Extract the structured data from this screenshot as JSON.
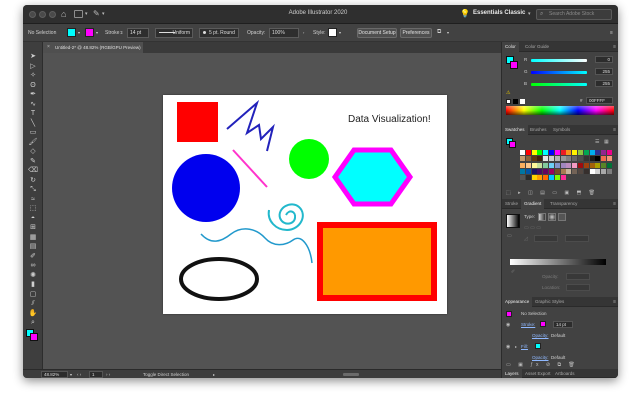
{
  "app": {
    "title": "Adobe Illustrator 2020",
    "workspace": "Essentials Classic",
    "stock_search_placeholder": "Search Adobe Stock"
  },
  "control_bar": {
    "selection": "No Selection",
    "stroke_label": "Stroke:",
    "stroke_weight": "14 pt",
    "variable_width": "Uniform",
    "brush": "5 pt. Round",
    "opacity_label": "Opacity:",
    "opacity_value": "100%",
    "style_label": "Style:",
    "document_setup": "Document Setup",
    "preferences": "Preferences",
    "fill_color": "#00ffff",
    "stroke_color": "#ff00ff"
  },
  "document_tab": {
    "label": "Untitled-2* @ 48.82% (RGB/GPU Preview)"
  },
  "toolbar": {
    "tools": [
      "selection-tool",
      "direct-selection-tool",
      "magic-wand-tool",
      "lasso-tool",
      "pen-tool",
      "curvature-tool",
      "type-tool",
      "line-tool",
      "rectangle-tool",
      "paintbrush-tool",
      "shaper-tool",
      "pencil-tool",
      "eraser-tool",
      "rotate-tool",
      "scale-tool",
      "width-tool",
      "free-transform-tool",
      "shape-builder-tool",
      "perspective-tool",
      "mesh-tool",
      "gradient-tool",
      "eyedropper-tool",
      "blend-tool",
      "symbol-sprayer-tool",
      "column-graph-tool",
      "artboard-tool",
      "slice-tool",
      "hand-tool",
      "zoom-tool"
    ],
    "fill_color": "#00ffff",
    "stroke_color": "#ff00ff"
  },
  "artboard": {
    "heading": "Data Visualization!",
    "shapes": {
      "red_square": "#ff0000",
      "blue_circle": "#0000ee",
      "green_circle": "#00ff00",
      "hexagon_fill": "#00ffff",
      "hexagon_stroke": "#ff00ff",
      "orange_rect_fill": "#ff9900",
      "orange_rect_stroke": "#ff0000",
      "zigzag_stroke": "#2222bb",
      "diagonal_line": "#ff33cc",
      "spiral_stroke": "#22b8cc",
      "wave_stroke": "#2299cc",
      "ellipse_stroke": "#111111"
    }
  },
  "status_bar": {
    "zoom": "48.82%",
    "artboard_number": "1",
    "tool_hint": "Toggle Direct Selection"
  },
  "color_panel": {
    "tabs": [
      "Color",
      "Color Guide"
    ],
    "channels": [
      {
        "label": "R",
        "value": "0"
      },
      {
        "label": "G",
        "value": "255"
      },
      {
        "label": "B",
        "value": "255"
      }
    ],
    "hex_label": "#",
    "hex_value": "00FFFF"
  },
  "swatches_panel": {
    "tabs": [
      "Swatches",
      "Brushes",
      "Symbols"
    ]
  },
  "gradient_panel": {
    "tabs": [
      "Stroke",
      "Gradient",
      "Transparency"
    ],
    "type_label": "Type:",
    "opacity_label": "Opacity:",
    "location_label": "Location:"
  },
  "appearance_panel": {
    "tabs": [
      "Appearance",
      "Graphic Styles"
    ],
    "selection": "No Selection",
    "stroke_label": "Stroke:",
    "stroke_weight": "14 pt",
    "opacity_label": "Opacity:",
    "opacity_value": "Default",
    "fill_label": "Fill:",
    "fill_opacity_label": "Opacity:",
    "fill_opacity_value": "Default"
  },
  "bottom_tabs": [
    "Layers",
    "Asset Export",
    "Artboards"
  ]
}
